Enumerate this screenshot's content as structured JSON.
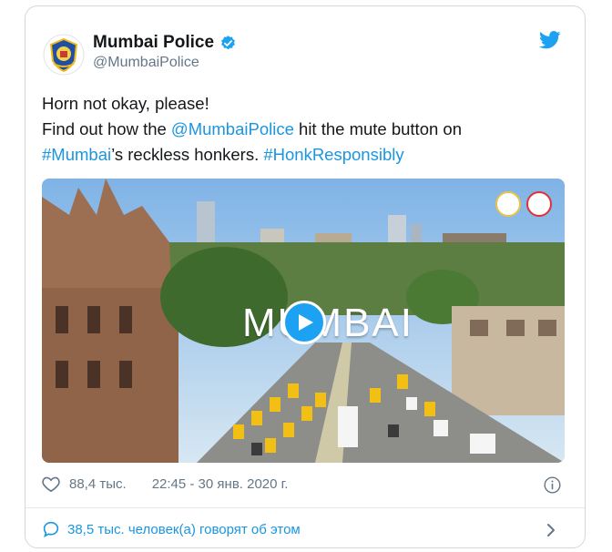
{
  "author": {
    "name": "Mumbai Police",
    "handle": "@MumbaiPolice"
  },
  "tweet": {
    "line1": "Horn not okay, please!",
    "line2_prefix": "Find out how the ",
    "line2_mention": "@MumbaiPolice",
    "line2_suffix": " hit the mute button on",
    "line3_hashtag1": "#Mumbai",
    "line3_mid": "’s reckless honkers. ",
    "line3_hashtag2": "#HonkResponsibly"
  },
  "media": {
    "video_title": "MUMBAI"
  },
  "footer": {
    "likes": "88,4 тыс.",
    "timestamp": "22:45 - 30 янв. 2020 г.",
    "talking": "38,5 тыс. человек(а) говорят об этом"
  },
  "colors": {
    "link": "#1b95e0",
    "text": "#14171a",
    "muted": "#657786",
    "border": "#cfd9de"
  },
  "icons": [
    "mumbai-police-logo",
    "verified-badge-icon",
    "twitter-bird-icon",
    "heart-icon",
    "info-icon",
    "speech-bubble-icon",
    "chevron-right-icon",
    "play-icon"
  ]
}
